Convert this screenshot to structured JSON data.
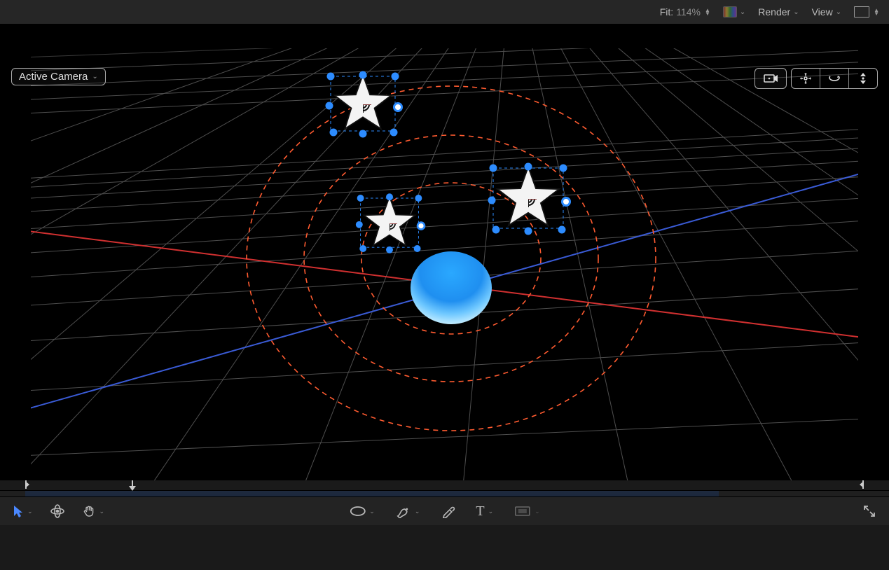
{
  "topbar": {
    "fit_label": "Fit:",
    "fit_value": "114%",
    "render_label": "Render",
    "view_label": "View"
  },
  "viewer": {
    "camera_popup": "Active Camera"
  },
  "toolbar": {
    "text_tool_label": "T"
  },
  "colors": {
    "xaxis": "#cc3030",
    "zaxis": "#3a5bd6",
    "orbit": "#ff5b30",
    "handle": "#2d8cff",
    "star_fill": "#f2f2f2",
    "sphere_top": "#2aa8ff",
    "sphere_bot": "#b8e6ff"
  }
}
